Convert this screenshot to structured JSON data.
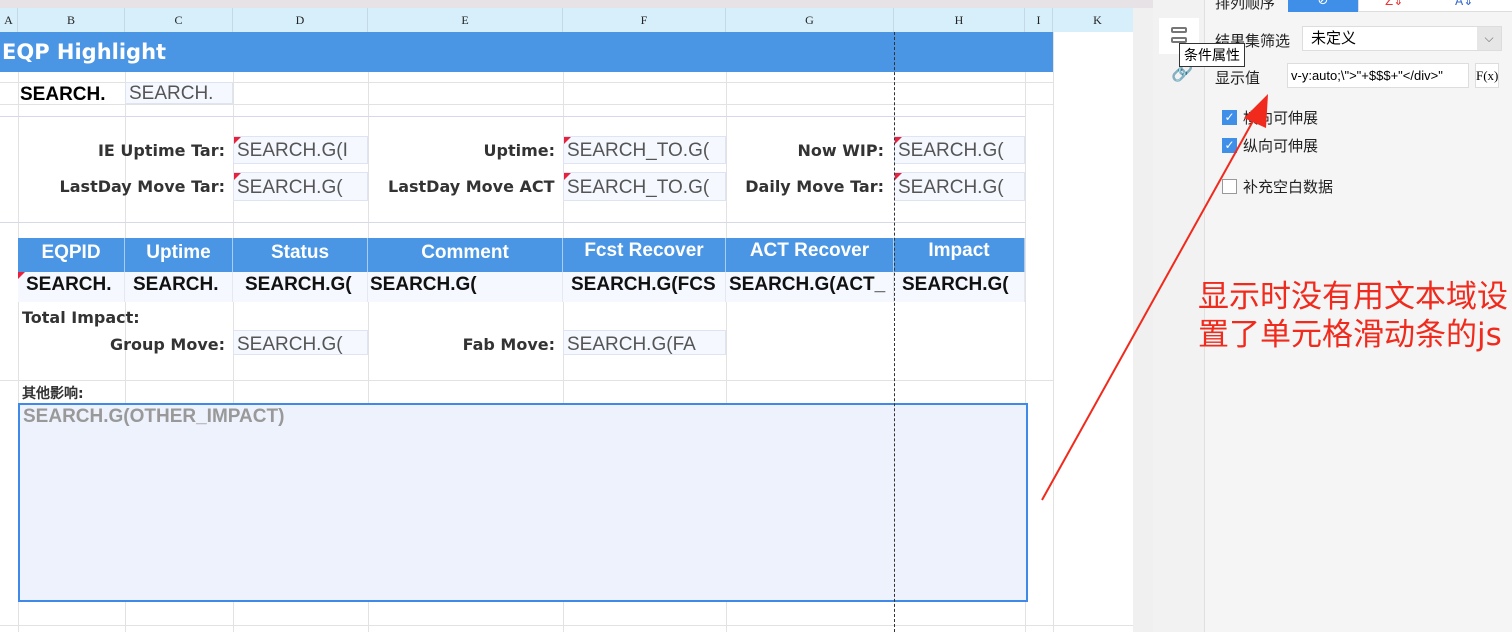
{
  "columns": [
    "A",
    "B",
    "C",
    "D",
    "E",
    "F",
    "G",
    "H",
    "I",
    "K"
  ],
  "report": {
    "title": "EQP Highlight",
    "search_row": [
      "SEARCH.",
      "SEARCH."
    ],
    "kpis": [
      {
        "label": "IE Uptime Tar:",
        "value": "SEARCH.G(I"
      },
      {
        "label": "Uptime:",
        "value": "SEARCH_TO.G("
      },
      {
        "label": "Now WIP:",
        "value": "SEARCH.G("
      },
      {
        "label": "LastDay Move Tar:",
        "value": "SEARCH.G("
      },
      {
        "label": "LastDay Move ACT",
        "value": "SEARCH_TO.G("
      },
      {
        "label": "Daily Move Tar:",
        "value": "SEARCH.G("
      }
    ],
    "table": {
      "headers": [
        "EQPID",
        "Uptime",
        "Status",
        "Comment",
        "Fcst Recover",
        "ACT Recover",
        "Impact"
      ],
      "row": [
        "SEARCH.",
        "SEARCH.",
        "SEARCH.G(",
        "SEARCH.G(",
        "SEARCH.G(FCS",
        "SEARCH.G(ACT_",
        "SEARCH.G("
      ]
    },
    "total_impact_label": "Total Impact:",
    "group_move_label": "Group Move:",
    "group_move_value": "SEARCH.G(",
    "fab_move_label": "Fab Move:",
    "fab_move_value": "SEARCH.G(FA",
    "other_label": "其他影响:",
    "other_value": "SEARCH.G(OTHER_IMPACT)"
  },
  "panel": {
    "sort_label": "排列顺序",
    "filter_label": "结果集筛选",
    "filter_value": "未定义",
    "tooltip": "条件属性",
    "display_label": "显示值",
    "display_value": "v-y:auto;\\\">\"+$$$+\"</div>\"",
    "fx_label": "F(x)",
    "checkboxes": [
      {
        "label": "横向可伸展",
        "checked": true
      },
      {
        "label": "纵向可伸展",
        "checked": true
      },
      {
        "label": "补充空白数据",
        "checked": false
      }
    ]
  },
  "annotation": "显示时没有用文本域设置了单元格滑动条的js",
  "colors": {
    "accent": "#4a96e4",
    "annotation": "#f02a1c"
  }
}
